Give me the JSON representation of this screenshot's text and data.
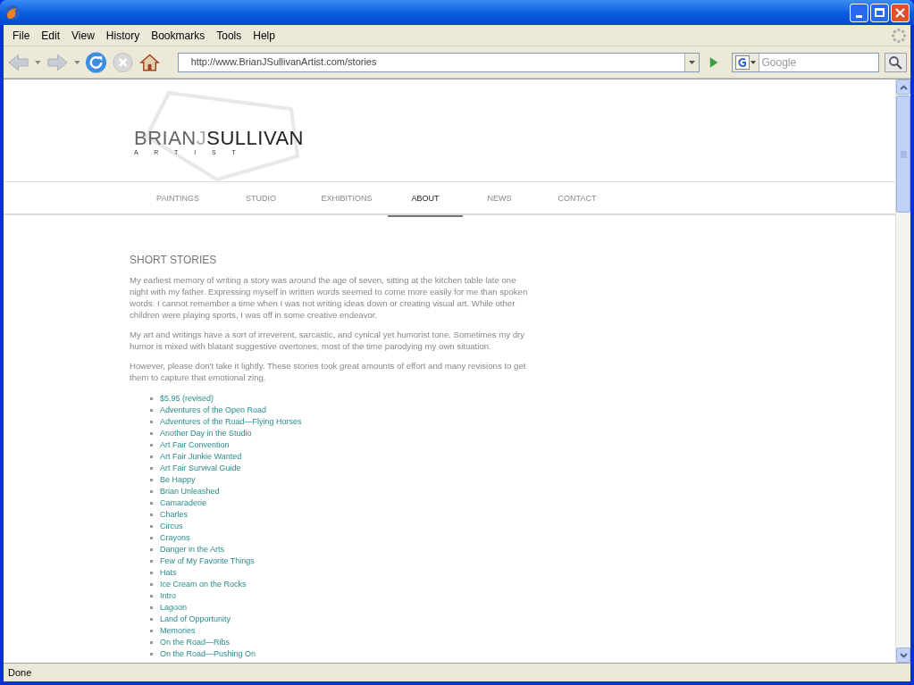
{
  "browser": {
    "menu": [
      "File",
      "Edit",
      "View",
      "History",
      "Bookmarks",
      "Tools",
      "Help"
    ],
    "url": "http://www.BrianJSullivanArtist.com/stories",
    "search_placeholder": "Google",
    "status": "Done"
  },
  "logo": {
    "first": "BRIAN",
    "middle": "J",
    "last": "SULLIVAN",
    "tagline": "A R T I S T"
  },
  "nav": [
    {
      "label": "PAINTINGS",
      "selected": false
    },
    {
      "label": "STUDIO",
      "selected": false
    },
    {
      "label": "EXHIBITIONS",
      "selected": false
    },
    {
      "label": "ABOUT",
      "selected": true
    },
    {
      "label": "NEWS",
      "selected": false
    },
    {
      "label": "CONTACT",
      "selected": false
    }
  ],
  "heading": "SHORT STORIES",
  "paragraphs": [
    "My earliest memory of writing a story was around the age of seven, sitting at the kitchen table late one night with my father. Expressing myself in written words seemed to come more easily for me than spoken words. I cannot remember a time when I was not writing ideas down or creating visual art. While other children were playing sports, I was off in some creative endeavor.",
    "My art and writings have a sort of irreverent, sarcastic, and cynical yet humorist tone. Sometimes my dry humor is mixed with blatant suggestive overtones, most of the time parodying my own situation.",
    "However, please don't take it lightly. These stories took great amounts of effort and many revisions to get them to capture that emotional zing."
  ],
  "stories": [
    "$5.95 (revised)",
    "Adventures of the Open Road",
    "Adventures of the Road—Flying Horses",
    "Another Day in the Studio",
    "Art Fair Convention",
    "Art Fair Junkie Wanted",
    "Art Fair Survival Guide",
    "Be Happy",
    "Brian Unleashed",
    "Camaraderie",
    "Charles",
    "Circus",
    "Crayons",
    "Danger in the Arts",
    "Few of My Favorite Things",
    "Hats",
    "Ice Cream on the Rocks",
    "Intro",
    "Lagoon",
    "Land of Opportunity",
    "Memories",
    "On the Road—Ribs",
    "On the Road—Pushing On"
  ]
}
